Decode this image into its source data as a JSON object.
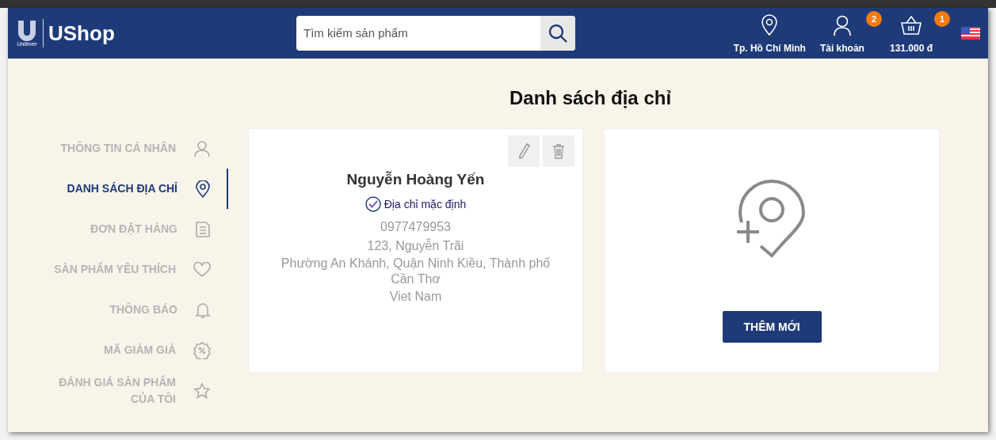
{
  "header": {
    "logo_mark": "Unilever",
    "logo_text": "UShop",
    "search": {
      "placeholder": "Tìm kiếm sản phẩm"
    },
    "actions": [
      {
        "kind": "location",
        "label": "Tp. Hồ Chí Minh"
      },
      {
        "kind": "account",
        "label": "Tài khoản",
        "badge": "2"
      },
      {
        "kind": "cart",
        "label": "131.000 đ",
        "badge": "1"
      }
    ]
  },
  "page_title": "Danh sách địa chỉ",
  "sidebar": {
    "items": [
      {
        "label": "THÔNG TIN CÁ NHÂN",
        "kind": "user",
        "selected": false
      },
      {
        "label": "DANH SÁCH ĐỊA CHỈ",
        "kind": "pin",
        "selected": true
      },
      {
        "label": "ĐƠN ĐẶT HÀNG",
        "kind": "doc",
        "selected": false
      },
      {
        "label": "SẢN PHẨM YÊU THÍCH",
        "kind": "heart",
        "selected": false
      },
      {
        "label": "THÔNG BÁO",
        "kind": "bell",
        "selected": false
      },
      {
        "label": "MÃ GIẢM GIÁ",
        "kind": "coupon",
        "selected": false
      },
      {
        "label": "ĐÁNH GIÁ SẢN PHẨM CỦA TÔI",
        "kind": "star",
        "selected": false
      }
    ]
  },
  "addresses": [
    {
      "name": "Nguyễn Hoàng Yến",
      "default": true,
      "default_label": "Địa chỉ mặc định",
      "phone": "0977479953",
      "street": "123, Nguyễn Trãi",
      "area": "Phường An Khánh, Quận Ninh Kiều, Thành phố Cần Thơ",
      "country": "Viet Nam"
    }
  ],
  "add_button": "THÊM MỚI"
}
